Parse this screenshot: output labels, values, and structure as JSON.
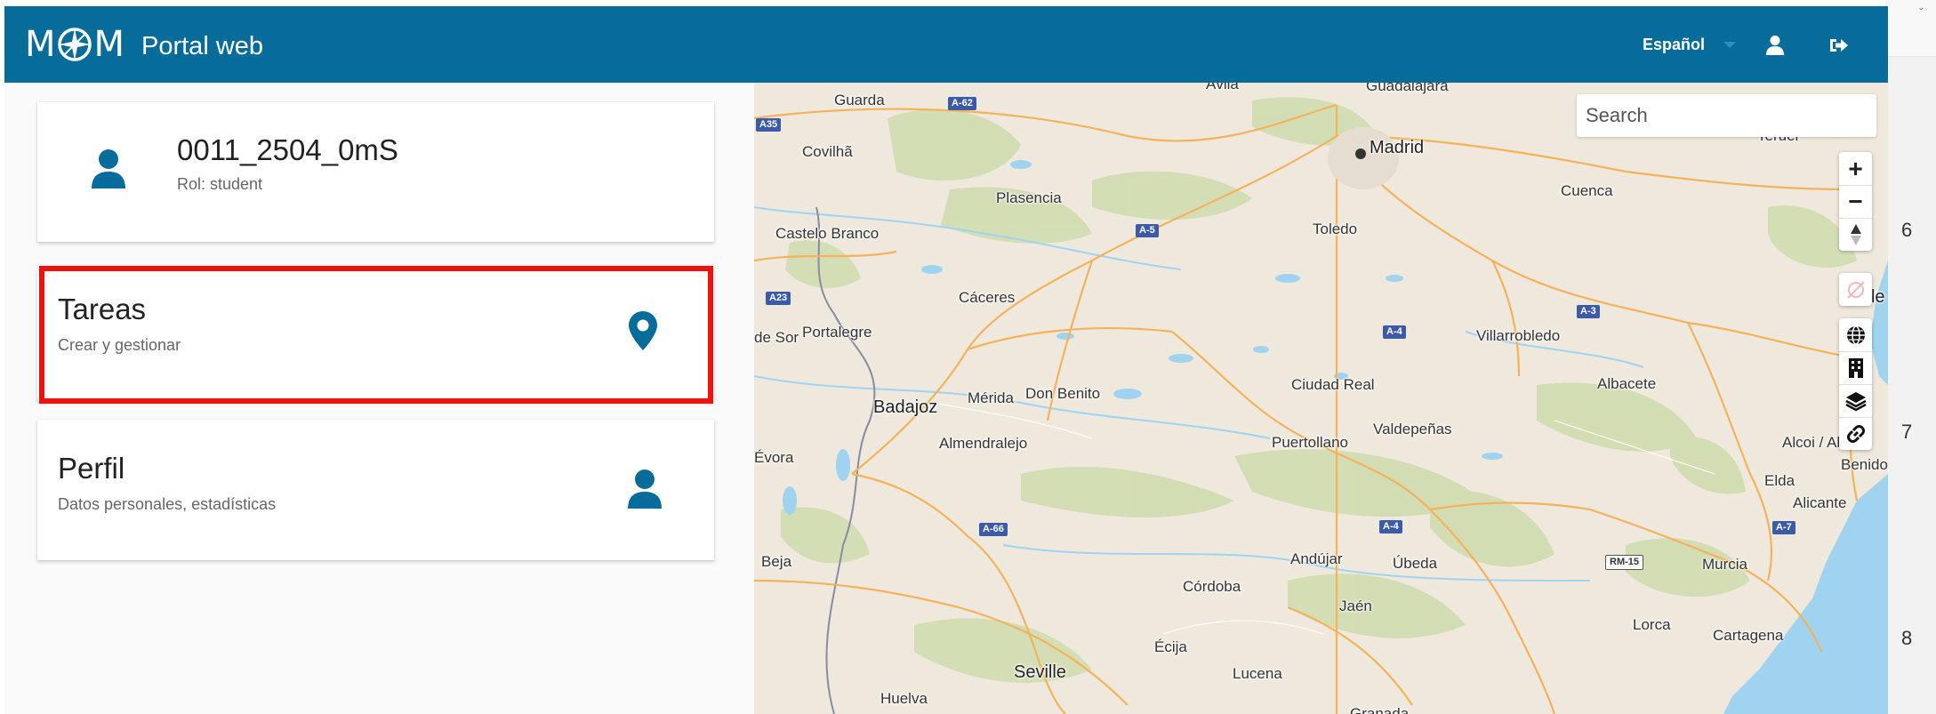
{
  "header": {
    "logo_left": "M",
    "logo_right": "M",
    "app_name": "Portal web",
    "language": "Español",
    "user_icon": "user-icon",
    "logout_icon": "sign-out-icon",
    "bg_color": "#076c99"
  },
  "user_card": {
    "username": "0011_2504_0mS",
    "role": "Rol: student",
    "icon": "user-icon"
  },
  "menu": {
    "tareas": {
      "title": "Tareas",
      "subtitle": "Crear y gestionar",
      "icon": "map-marker-icon"
    },
    "perfil": {
      "title": "Perfil",
      "subtitle": "Datos personales, estadísticas",
      "icon": "user-icon"
    }
  },
  "map": {
    "search_placeholder": "Search",
    "controls": {
      "zoom_in": "+",
      "zoom_out": "−",
      "compass": "compass-icon",
      "no_location": "location-disabled-icon",
      "globe": "globe-icon",
      "buildings": "building-icon",
      "layers": "layers-icon",
      "link": "link-icon"
    },
    "labels": {
      "guarda": "Guarda",
      "covilha": "Covilhã",
      "plasencia": "Plasencia",
      "castelo_branco": "Castelo Branco",
      "madrid": "Madrid",
      "toledo": "Toledo",
      "cuenca": "Cuenca",
      "caceres": "Cáceres",
      "de_sor": "de Sor",
      "portalegre": "Portalegre",
      "badajoz": "Badajoz",
      "merida": "Mérida",
      "don_benito": "Don Benito",
      "almendralejo": "Almendralejo",
      "evora": "Évora",
      "villarrobledo": "Villarrobledo",
      "ciudad_real": "Ciudad Real",
      "albacete": "Albacete",
      "valdepenas": "Valdepeñas",
      "puertollano": "Puertollano",
      "beja": "Beja",
      "andujar": "Andújar",
      "ubeda": "Úbeda",
      "cordoba": "Córdoba",
      "jaen": "Jaén",
      "ecija": "Écija",
      "seville": "Seville",
      "lucena": "Lucena",
      "huelva": "Huelva",
      "murcia": "Murcia",
      "lorca": "Lorca",
      "cartagena": "Cartagena",
      "elda": "Elda",
      "alicante": "Alicante",
      "alcoi": "Alcoi / Al",
      "benido": "Benido",
      "guadalajara": "Guadalajara",
      "teruel": "Teruel",
      "vale": "Vale",
      "granada": "Granada",
      "avila": "Ávila"
    },
    "shields": {
      "a62": "A-62",
      "a35": "A35",
      "a5": "A-5",
      "a23": "A23",
      "a3": "A-3",
      "a4": "A-4",
      "a4b": "A-4",
      "a66": "A-66",
      "rm15": "RM-15",
      "a7": "A-7"
    }
  },
  "browser_strip": {
    "chevron": "ˇ",
    "n6": "6",
    "n7": "7",
    "n8": "8"
  }
}
